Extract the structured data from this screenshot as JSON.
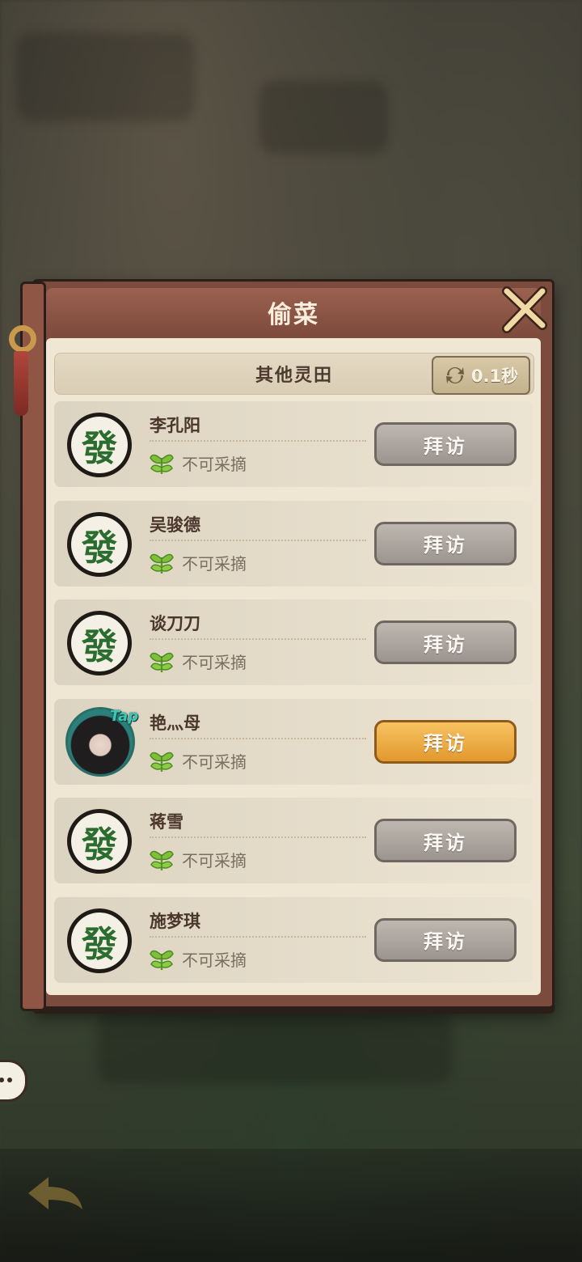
{
  "panel": {
    "title": "偷菜",
    "sub_title": "其他灵田",
    "timer": "0.1秒"
  },
  "players": [
    {
      "name": "李孔阳",
      "status": "不可采摘",
      "button": "拜访",
      "avatar": "發",
      "active": false
    },
    {
      "name": "吴骏德",
      "status": "不可采摘",
      "button": "拜访",
      "avatar": "發",
      "active": false
    },
    {
      "name": "谈刀刀",
      "status": "不可采摘",
      "button": "拜访",
      "avatar": "發",
      "active": false
    },
    {
      "name": "艳灬母",
      "status": "不可采摘",
      "button": "拜访",
      "avatar": "",
      "active": true,
      "badge": "Tap"
    },
    {
      "name": "蒋雪",
      "status": "不可采摘",
      "button": "拜访",
      "avatar": "發",
      "active": false
    },
    {
      "name": "施梦琪",
      "status": "不可采摘",
      "button": "拜访",
      "avatar": "發",
      "active": false
    }
  ],
  "colors": {
    "panel_border": "#7b4c3d",
    "active_button": "#f0b048",
    "inactive_button": "#aca6a0",
    "avatar_glyph": "#2a6d2f"
  },
  "icons": {
    "close": "close-x-icon",
    "timer": "refresh-icon",
    "status": "leaf-icon",
    "back": "back-arrow-icon",
    "chat": "chat-bubble-icon"
  }
}
